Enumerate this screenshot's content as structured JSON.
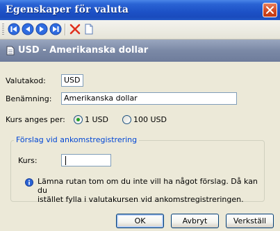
{
  "window": {
    "title": "Egenskaper för valuta"
  },
  "toolbar": {
    "buttons": [
      {
        "icon": "first-record-icon"
      },
      {
        "icon": "previous-record-icon"
      },
      {
        "icon": "next-record-icon"
      },
      {
        "icon": "last-record-icon"
      },
      {
        "icon": "delete-icon"
      },
      {
        "icon": "new-document-icon"
      }
    ]
  },
  "header": {
    "title": "USD - Amerikanska dollar"
  },
  "form": {
    "code_label": "Valutakod:",
    "code_value": "USD",
    "name_label": "Benämning:",
    "name_value": "Amerikanska dollar",
    "rate_label": "Kurs anges per:",
    "rate_options": [
      "1 USD",
      "100 USD"
    ],
    "rate_selected": "1 USD"
  },
  "group": {
    "title": "Förslag vid ankomstregistrering",
    "kurs_label": "Kurs:",
    "kurs_value": "",
    "info_line1": "Lämna rutan tom om du inte vill ha något förslag. Då kan du",
    "info_line2": "istället fylla i valutakursen vid ankomstregistreringen."
  },
  "buttons": {
    "ok": "OK",
    "cancel": "Avbryt",
    "apply": "Verkställ"
  },
  "colors": {
    "titlebar": "#2a63d4",
    "header": "#7b89a6",
    "accent_green": "#21a121",
    "groupbox_title": "#0046d5"
  }
}
